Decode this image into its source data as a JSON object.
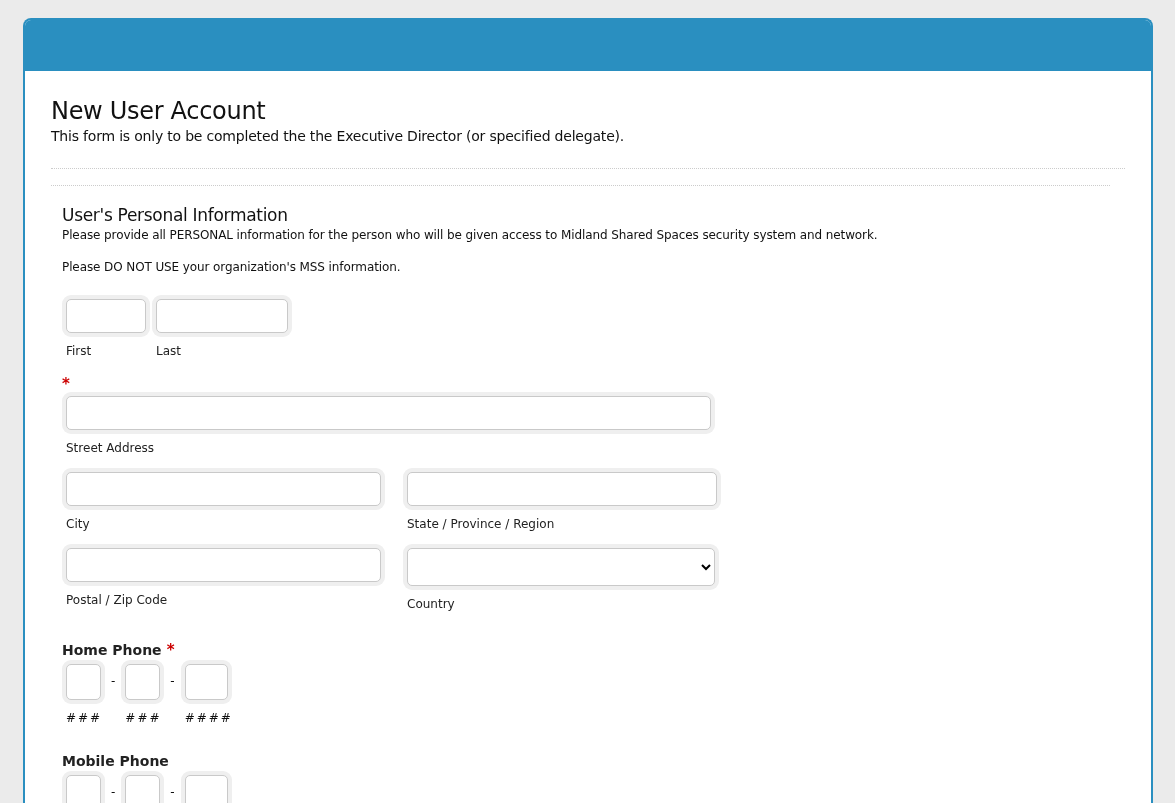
{
  "form": {
    "title": "New User Account",
    "description": "This form is only to be completed the the Executive Director (or specified delegate)."
  },
  "section": {
    "title": "User's Personal Information",
    "paragraphs": [
      "Please provide all PERSONAL information for the person who will be given access to Midland Shared Spaces security system and network.",
      "Please DO NOT USE your organization's MSS information."
    ]
  },
  "name_fields": [
    {
      "sublabel": "First"
    },
    {
      "sublabel": "Last"
    }
  ],
  "address": {
    "required_mark": "*",
    "rows": [
      [
        {
          "kind": "text",
          "sublabel": "Street Address"
        }
      ],
      [
        {
          "kind": "text",
          "sublabel": "City"
        },
        {
          "kind": "text",
          "sublabel": "State / Province / Region"
        }
      ],
      [
        {
          "kind": "text",
          "sublabel": "Postal / Zip Code"
        },
        {
          "kind": "select",
          "sublabel": "Country"
        }
      ]
    ]
  },
  "phones": [
    {
      "label": "Home Phone",
      "required_mark": "*",
      "parts": [
        {
          "kind": "digits",
          "sublabel": "###",
          "separator": "-"
        },
        {
          "kind": "digits",
          "sublabel": "###",
          "separator": "-"
        },
        {
          "kind": "digits",
          "sublabel": "####"
        }
      ]
    },
    {
      "label": "Mobile Phone",
      "parts": [
        {
          "kind": "digits",
          "separator": "-"
        },
        {
          "kind": "digits",
          "separator": "-"
        },
        {
          "kind": "digits"
        }
      ]
    }
  ]
}
